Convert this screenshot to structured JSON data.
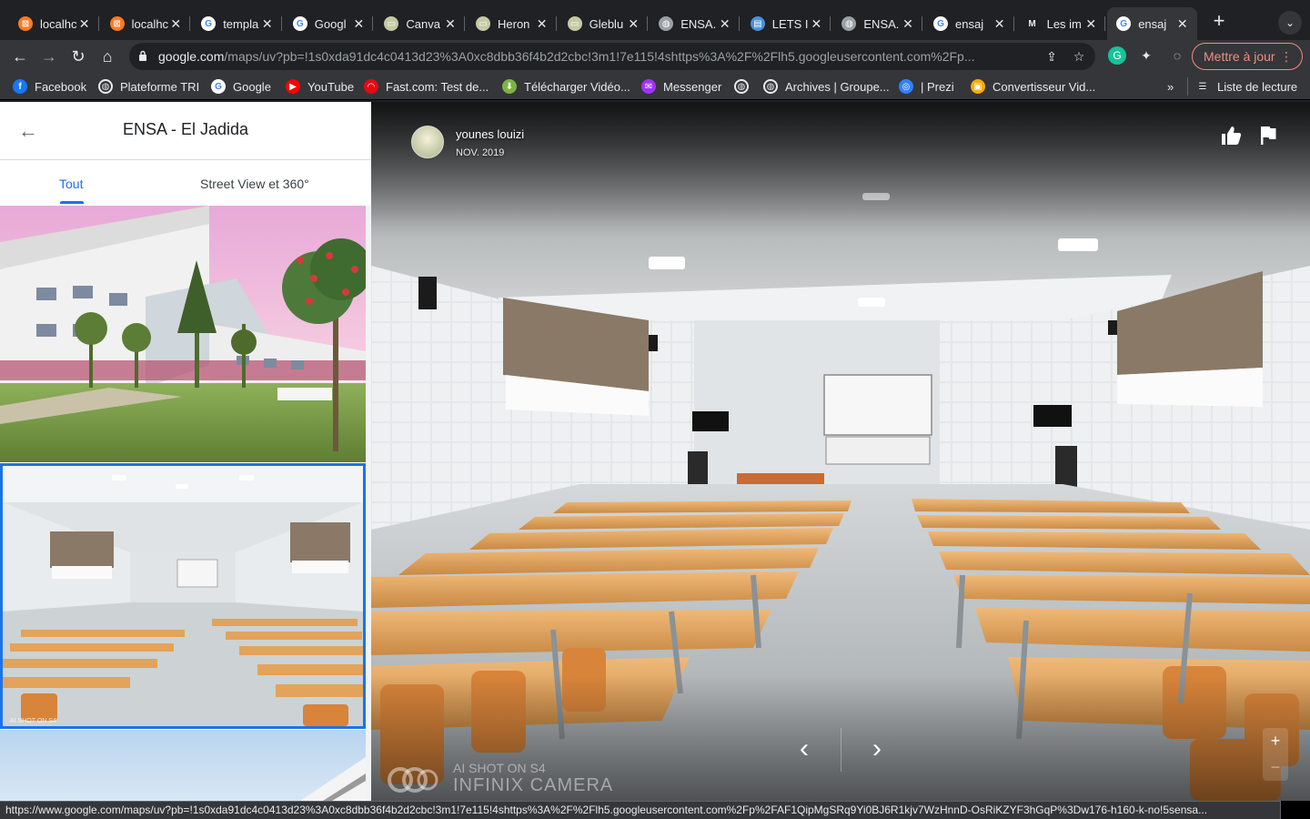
{
  "browser": {
    "tabs": [
      {
        "title": "localhc",
        "icon": "xampp-icon"
      },
      {
        "title": "localhc",
        "icon": "xampp-icon"
      },
      {
        "title": "templa",
        "icon": "google-icon"
      },
      {
        "title": "Googl",
        "icon": "google-icon"
      },
      {
        "title": "Canva",
        "icon": "image-icon"
      },
      {
        "title": "Heron",
        "icon": "image-icon"
      },
      {
        "title": "Gleblu",
        "icon": "image-icon"
      },
      {
        "title": "ENSA.",
        "icon": "globe-icon"
      },
      {
        "title": "LETS I",
        "icon": "doc-icon"
      },
      {
        "title": "ENSA.",
        "icon": "globe-icon"
      },
      {
        "title": "ensaj",
        "icon": "google-icon"
      },
      {
        "title": "Les im",
        "icon": "medium-icon"
      },
      {
        "title": "ensaj",
        "icon": "google-icon",
        "active": true
      }
    ],
    "url_host": "google.com",
    "url_path": "/maps/uv?pb=!1s0xda91dc4c0413d23%3A0xc8dbb36f4b2d2cbc!3m1!7e115!4shttps%3A%2F%2Flh5.googleusercontent.com%2Fp...",
    "update_button": "Mettre à jour",
    "bookmarks": [
      {
        "label": "Facebook",
        "icon": "facebook-icon",
        "color": "#1877f2"
      },
      {
        "label": "Plateforme TRI",
        "icon": "globe-icon",
        "color": "#e8eaed"
      },
      {
        "label": "Google",
        "icon": "google-icon",
        "color": "#ffffff"
      },
      {
        "label": "YouTube",
        "icon": "youtube-icon",
        "color": "#ff0000"
      },
      {
        "label": "Fast.com: Test de...",
        "icon": "fast-icon",
        "color": "#e50914"
      },
      {
        "label": "Télécharger Vidéo...",
        "icon": "download-icon",
        "color": "#7cb342"
      },
      {
        "label": "Messenger",
        "icon": "messenger-icon",
        "color": "#a033ff"
      },
      {
        "label": "",
        "icon": "globe-icon",
        "color": "#e8eaed"
      },
      {
        "label": "Archives | Groupe...",
        "icon": "globe-icon",
        "color": "#e8eaed"
      },
      {
        "label": "| Prezi",
        "icon": "prezi-icon",
        "color": "#3181ff"
      },
      {
        "label": "Convertisseur Vid...",
        "icon": "converter-icon",
        "color": "#f9ab00"
      }
    ],
    "reading_list": "Liste de lecture",
    "more_bookmarks": "»",
    "status_url": "https://www.google.com/maps/uv?pb=!1s0xda91dc4c0413d23%3A0xc8dbb36f4b2d2cbc!3m1!7e115!4shttps%3A%2F%2Flh5.googleusercontent.com%2Fp%2FAF1QipMgSRq9Yi0BJ6R1kjv7WzHnnD-OsRiKZYF3hGqP%3Dw176-h160-k-no!5sensa..."
  },
  "panel": {
    "title": "ENSA - El Jadida",
    "tabs": [
      "Tout",
      "Street View et 360°"
    ],
    "active_tab": 0
  },
  "viewer": {
    "author": "younes louizi",
    "date": "NOV. 2019",
    "watermark_line1": "AI SHOT ON S4",
    "watermark_line2": "INFINIX CAMERA",
    "thumb_watermark_line1": "AI SHOT ON S4",
    "thumb_watermark_line2": "INFINIX CAMERA",
    "zoom_in": "+",
    "zoom_out": "−"
  }
}
